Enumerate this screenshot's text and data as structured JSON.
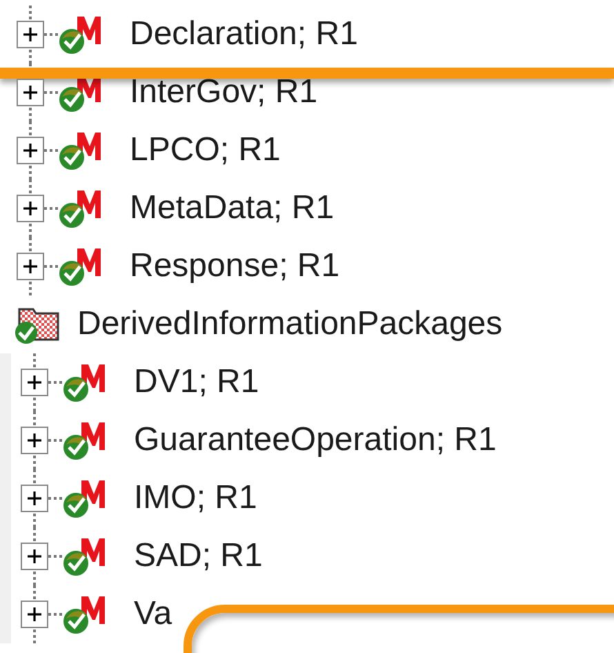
{
  "groups": [
    {
      "items": [
        {
          "label": "Declaration; R1",
          "expanded": false
        },
        {
          "label": "InterGov; R1",
          "expanded": false
        },
        {
          "label": "LPCO; R1",
          "expanded": false
        },
        {
          "label": "MetaData; R1",
          "expanded": false
        },
        {
          "label": "Response; R1",
          "expanded": false
        }
      ]
    },
    {
      "header": "DerivedInformationPackages",
      "items": [
        {
          "label": "DV1; R1",
          "expanded": false
        },
        {
          "label": "GuaranteeOperation; R1",
          "expanded": false
        },
        {
          "label": "IMO; R1",
          "expanded": false
        },
        {
          "label": "SAD; R1",
          "expanded": false
        },
        {
          "label": "Va",
          "expanded": false
        }
      ]
    }
  ]
}
